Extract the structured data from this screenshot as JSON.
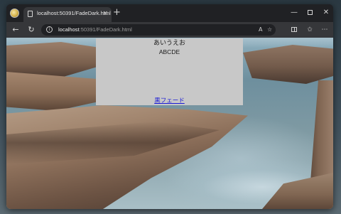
{
  "browser": {
    "tab": {
      "title": "localhost:50391/FadeDark.html",
      "close_glyph": "×"
    },
    "new_tab_glyph": "+",
    "window_controls": {
      "minimize_glyph": "—",
      "close_glyph": "✕"
    },
    "toolbar": {
      "back_glyph": "←",
      "reload_glyph": "↻",
      "url_host": "localhost",
      "url_rest": ":50391/FadeDark.html",
      "read_aloud_glyph": "A",
      "favorite_glyph": "☆",
      "more_glyph": "⋯",
      "favorites_bar_glyph": "✩"
    },
    "icons": {
      "app": "browser-profile-icon",
      "tab_doc": "document-icon",
      "info": "info-icon"
    },
    "colors": {
      "frame": "#202124",
      "toolbar": "#36373a",
      "link": "#1a1ad6",
      "content_box": "#c8c8c8"
    }
  },
  "page": {
    "line1": "あいうえお",
    "line2": "ABCDE",
    "link_text": "黒フェード"
  }
}
